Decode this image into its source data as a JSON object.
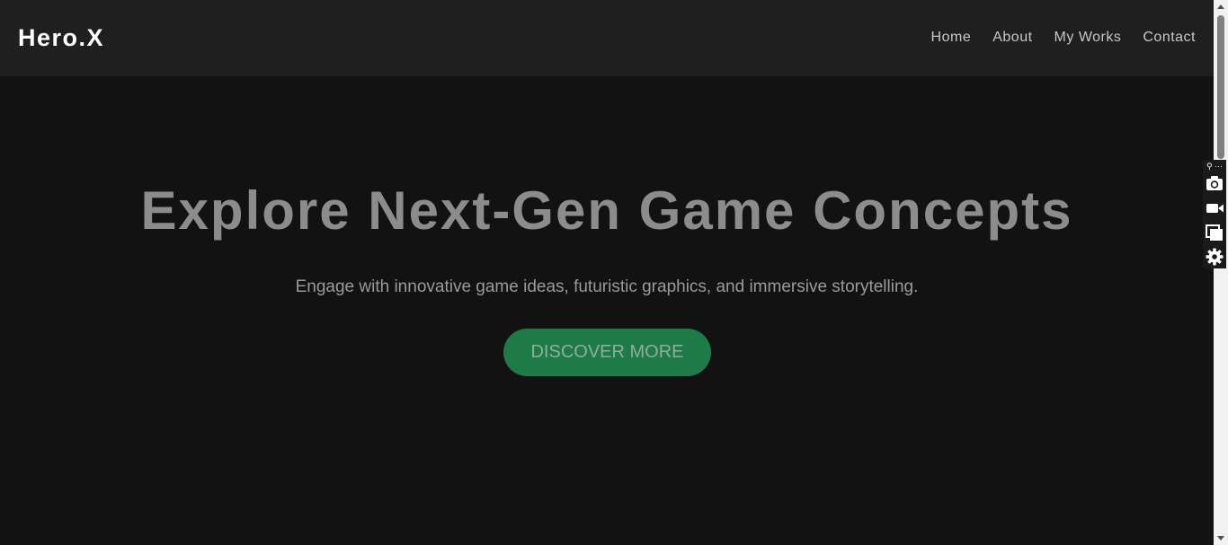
{
  "nav": {
    "logo": "Hero.X",
    "links": [
      "Home",
      "About",
      "My Works",
      "Contact"
    ]
  },
  "hero": {
    "title": "Explore Next-Gen Game Concepts",
    "subtitle": "Engage with innovative game ideas, futuristic graphics, and immersive storytelling.",
    "cta_label": "DISCOVER MORE"
  },
  "toolbar": {
    "top_glyph": "⚲ ···",
    "icons": [
      "camera-icon",
      "video-icon",
      "copy-icon",
      "gear-icon"
    ]
  },
  "colors": {
    "background": "#121212",
    "navbar": "#1f1f1f",
    "accent": "#1e7a46",
    "title": "#8c8c8c"
  }
}
